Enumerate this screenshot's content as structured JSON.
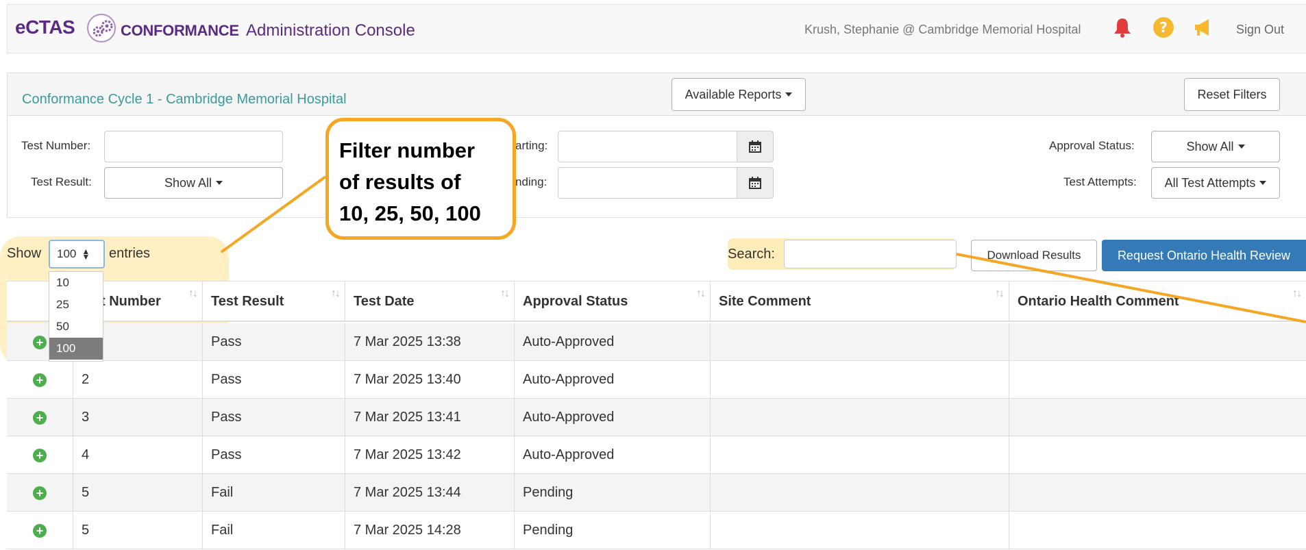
{
  "header": {
    "brand": "eCTAS",
    "brand_sub": "CONFORMANCE",
    "app_title": "Administration Console",
    "user": "Krush, Stephanie @ Cambridge Memorial Hospital",
    "sign_out": "Sign Out",
    "colors": {
      "brand": "#5b2a83",
      "bell": "#e23b3b",
      "help": "#f5b82e",
      "announce": "#f5b82e"
    }
  },
  "panel": {
    "title": "Conformance Cycle 1 - Cambridge Memorial Hospital",
    "available_reports": "Available Reports",
    "reset_filters": "Reset Filters",
    "filters": {
      "test_number_label": "Test Number:",
      "test_number_value": "",
      "test_result_label": "Test Result:",
      "test_result_value": "Show All",
      "starting_label": "arting:",
      "starting_value": "",
      "ending_label": "nding:",
      "ending_value": "",
      "approval_status_label": "Approval Status:",
      "approval_status_value": "Show All",
      "test_attempts_label": "Test Attempts:",
      "test_attempts_value": "All Test Attempts"
    }
  },
  "controls": {
    "show_label": "Show",
    "length_value": "100",
    "length_options": [
      "10",
      "25",
      "50",
      "100"
    ],
    "entries_label": "entries",
    "search_label": "Search:",
    "search_value": "",
    "download_results": "Download Results",
    "request_review": "Request Ontario Health Review"
  },
  "table": {
    "columns": [
      "",
      "Test Number",
      "Test Result",
      "Test Date",
      "Approval Status",
      "Site Comment",
      "Ontario Health Comment"
    ],
    "header_visible": [
      "",
      "t Number",
      "Test Result",
      "Test Date",
      "Approval Status",
      "Site Comment",
      "Ontario Health Comment"
    ],
    "rows": [
      {
        "num": "",
        "result": "Pass",
        "date": "7 Mar 2025 13:38",
        "status": "Auto-Approved",
        "site_comment": "",
        "oh_comment": ""
      },
      {
        "num": "2",
        "result": "Pass",
        "date": "7 Mar 2025 13:40",
        "status": "Auto-Approved",
        "site_comment": "",
        "oh_comment": ""
      },
      {
        "num": "3",
        "result": "Pass",
        "date": "7 Mar 2025 13:41",
        "status": "Auto-Approved",
        "site_comment": "",
        "oh_comment": ""
      },
      {
        "num": "4",
        "result": "Pass",
        "date": "7 Mar 2025 13:42",
        "status": "Auto-Approved",
        "site_comment": "",
        "oh_comment": ""
      },
      {
        "num": "5",
        "result": "Fail",
        "date": "7 Mar 2025 13:44",
        "status": "Pending",
        "site_comment": "",
        "oh_comment": ""
      },
      {
        "num": "5",
        "result": "Fail",
        "date": "7 Mar 2025 14:28",
        "status": "Pending",
        "site_comment": "",
        "oh_comment": ""
      }
    ]
  },
  "annotation": {
    "callout_lines": [
      "Filter number",
      "of results of",
      "10, 25, 50, 100"
    ],
    "color": "#f5a623"
  }
}
